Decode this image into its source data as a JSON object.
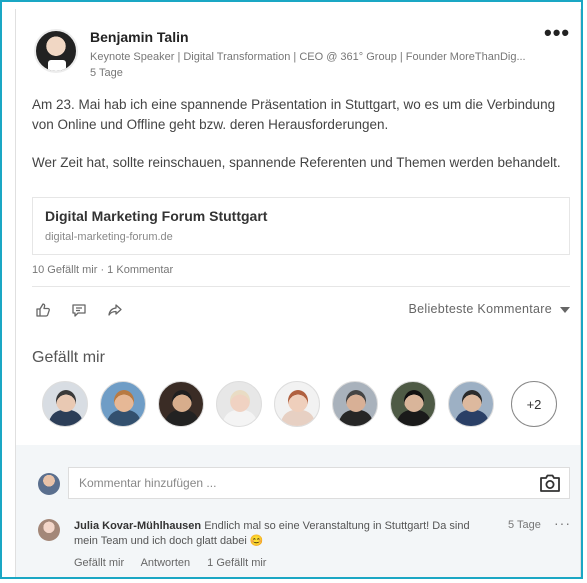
{
  "post": {
    "author": {
      "name": "Benjamin Talin",
      "headline": "Keynote Speaker | Digital Transformation | CEO @ 361° Group | Founder MoreThanDig...",
      "age": "5 Tage"
    },
    "menu_label": "•••",
    "paragraphs": [
      "Am 23. Mai hab ich eine spannende Präsentation in Stuttgart, wo es um die Verbindung von Online und Offline geht bzw. deren Herausforderungen.",
      "Wer Zeit hat, sollte reinschauen, spannende Referenten und Themen werden behandelt."
    ],
    "link": {
      "title": "Digital Marketing Forum Stuttgart",
      "domain": "digital-marketing-forum.de"
    },
    "social_counts": "10 Gefällt mir · 1 Kommentar",
    "actions": {
      "like_icon": "thumbs-up-icon",
      "comment_icon": "comment-icon",
      "share_icon": "share-icon",
      "sort_label": "Beliebteste Kommentare",
      "sort_icon": "caret-down-icon"
    }
  },
  "likes": {
    "title": "Gefällt mir",
    "avatars": [
      {
        "skin": "#e9c9b3",
        "hair": "#3a3a3a",
        "shirt": "#2c3e58",
        "bg": "#d8dde3"
      },
      {
        "skin": "#e6b896",
        "hair": "#b87a42",
        "shirt": "#33506e",
        "bg": "#6f9dc6"
      },
      {
        "skin": "#d7ad8c",
        "hair": "#1f1f1f",
        "shirt": "#222222",
        "bg": "#3a2c25"
      },
      {
        "skin": "#f0d2c2",
        "hair": "#e9dcc4",
        "shirt": "#f4f4f4",
        "bg": "#e7e7e7"
      },
      {
        "skin": "#efcfbc",
        "hair": "#b0603f",
        "shirt": "#e7d0c3",
        "bg": "#f2f2f2"
      },
      {
        "skin": "#d8b096",
        "hair": "#444444",
        "shirt": "#262626",
        "bg": "#a9b2bc"
      },
      {
        "skin": "#d9b59a",
        "hair": "#111111",
        "shirt": "#1a1a1a",
        "bg": "#4e5a45"
      },
      {
        "skin": "#ddb99e",
        "hair": "#2b2b2b",
        "shirt": "#2a3f66",
        "bg": "#9db0c4"
      }
    ],
    "more_label": "+2"
  },
  "comments": {
    "placeholder": "Kommentar hinzufügen ...",
    "camera_icon": "camera-icon",
    "items": [
      {
        "author": "Julia Kovar-Mühlhausen",
        "text": "Endlich mal so eine Veranstaltung in Stuttgart! Da sind mein Team und ich doch glatt dabei 😊",
        "time": "5 Tage",
        "more": "···",
        "like_label": "Gefällt mir",
        "reply_label": "Antworten",
        "likes": "1 Gefällt mir"
      }
    ]
  },
  "colors": {
    "frame_border": "#1aa7c4",
    "comments_bg": "#f3f6f8"
  }
}
